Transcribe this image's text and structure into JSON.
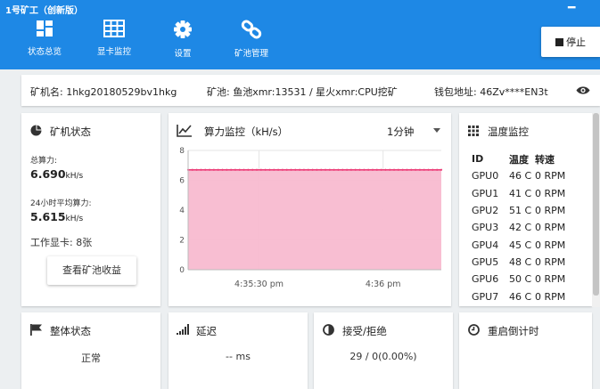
{
  "window": {
    "title": "1号矿工（创新版）",
    "minimize": "━"
  },
  "nav": [
    {
      "label": "状态总览",
      "icon": "dashboard-icon"
    },
    {
      "label": "显卡监控",
      "icon": "table-icon"
    },
    {
      "label": "设置",
      "icon": "gear-icon"
    },
    {
      "label": "矿池管理",
      "icon": "link-icon"
    }
  ],
  "toolbar": {
    "stop_label": "停止"
  },
  "info_bar": {
    "miner_name": "矿机名: 1hkg20180529bv1hkg",
    "pool": "矿池: 鱼池xmr:13531 / 星火xmr:CPU挖矿",
    "wallet": "钱包地址: 46Zv****EN3t"
  },
  "miner_status": {
    "title": "矿机状态",
    "total_hashrate_label": "总算力:",
    "total_hashrate_value": "6.690",
    "total_hashrate_unit": "kH/s",
    "avg_label": "24小时平均算力:",
    "avg_value": "5.615",
    "avg_unit": "kH/s",
    "gpu_count": "工作显卡: 8张",
    "earnings_button": "查看矿池收益"
  },
  "hashrate_monitor": {
    "title": "算力监控（kH/s）",
    "interval": "1分钟"
  },
  "chart_data": {
    "type": "area",
    "x_ticks": [
      "4:35:30 pm",
      "4:36 pm"
    ],
    "y_ticks": [
      "0",
      "2",
      "4",
      "6",
      "8"
    ],
    "ylim": [
      0,
      8
    ],
    "values": [
      6.7,
      6.7,
      6.7,
      6.7,
      6.7,
      6.7,
      6.7,
      6.7,
      6.7,
      6.7,
      6.7,
      6.7,
      6.7,
      6.7,
      6.7,
      6.7,
      6.7,
      6.7,
      6.7,
      6.7,
      6.7,
      6.7,
      6.7,
      6.7,
      6.7,
      6.7,
      6.7,
      6.7,
      6.7,
      6.7,
      6.7,
      6.7,
      6.7,
      6.7,
      6.7,
      6.7,
      6.7,
      6.7,
      6.7,
      6.7,
      6.7,
      6.7,
      6.7,
      6.7,
      6.7,
      6.7,
      6.7,
      6.7,
      6.7,
      6.7,
      6.7,
      6.7,
      6.7,
      6.7,
      6.7,
      6.7,
      6.7,
      6.7,
      6.7,
      6.7
    ],
    "grid": true,
    "colors": {
      "fill": "#f8bbd0",
      "line": "#ec407a"
    }
  },
  "temperature": {
    "title": "温度监控",
    "headers": [
      "ID",
      "温度",
      "转速"
    ],
    "rows": [
      [
        "GPU0",
        "46 C",
        "0 RPM"
      ],
      [
        "GPU1",
        "41 C",
        "0 RPM"
      ],
      [
        "GPU2",
        "51 C",
        "0 RPM"
      ],
      [
        "GPU3",
        "42 C",
        "0 RPM"
      ],
      [
        "GPU4",
        "45 C",
        "0 RPM"
      ],
      [
        "GPU5",
        "48 C",
        "0 RPM"
      ],
      [
        "GPU6",
        "50 C",
        "0 RPM"
      ],
      [
        "GPU7",
        "46 C",
        "0 RPM"
      ]
    ]
  },
  "overall": {
    "title": "整体状态",
    "value": "正常"
  },
  "latency": {
    "title": "延迟",
    "value": "-- ms"
  },
  "accept": {
    "title": "接受/拒绝",
    "value": "29 / 0(0.00%)"
  },
  "restart": {
    "title": "重启倒计时"
  },
  "colors": {
    "header": "#1e88e5",
    "background": "#eceff1"
  }
}
